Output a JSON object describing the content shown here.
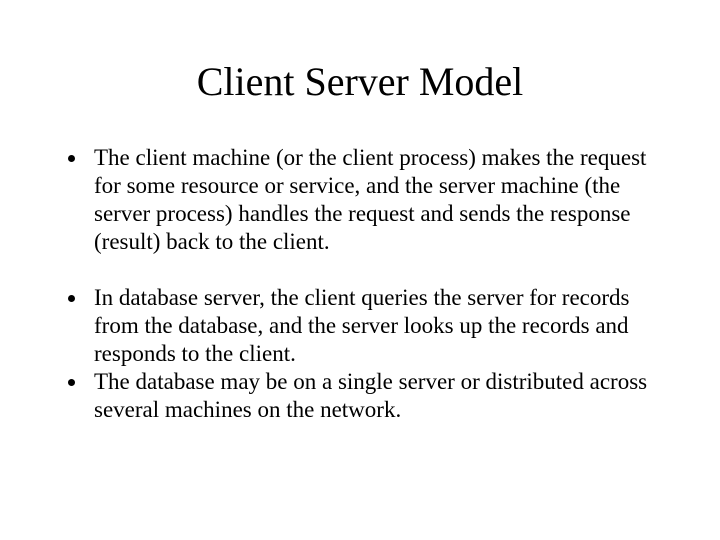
{
  "slide": {
    "title": "Client Server Model",
    "bullets": [
      "The client machine (or the client process) makes the request for some resource or service, and the server machine (the server process) handles the request and sends the response (result) back to the client.",
      "In database server, the client queries the server for records from the database, and the server looks up the records and responds to the client.",
      "The database may be on a single server or distributed across several machines on the network."
    ]
  }
}
